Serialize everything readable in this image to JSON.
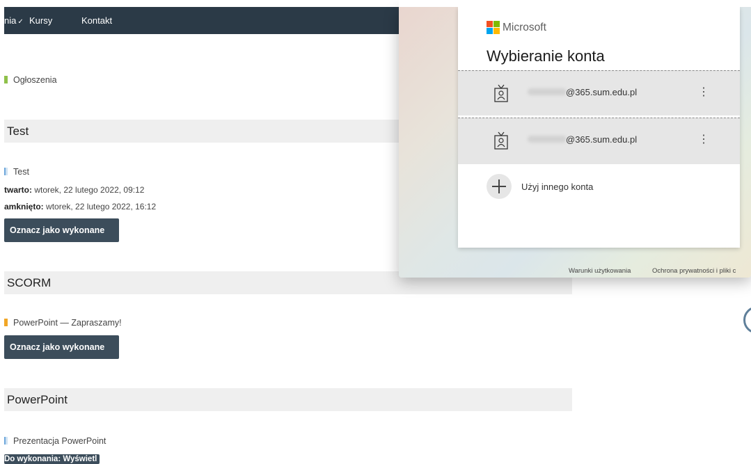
{
  "nav": {
    "menu_label": "nia",
    "kursy": "Kursy",
    "kontakt": "Kontakt"
  },
  "course": {
    "announcements": "Ogłoszenia",
    "sections": [
      {
        "title": "Test",
        "activity": "Test",
        "opened_label": "twarto:",
        "opened_value": " wtorek, 22 lutego 2022, 09:12",
        "closed_label": "amknięto:",
        "closed_value": " wtorek, 22 lutego 2022, 16:12",
        "button": "Oznacz jako wykonane"
      },
      {
        "title": "SCORM",
        "activity": "PowerPoint — Zapraszamy!",
        "button": "Oznacz jako wykonane"
      },
      {
        "title": "PowerPoint",
        "activity": "Prezentacja PowerPoint",
        "badge": "Do wykonania: Wyświetl"
      }
    ]
  },
  "popup": {
    "brand": "Microsoft",
    "title": "Wybieranie konta",
    "accounts": [
      {
        "email": "@365.sum.edu.pl",
        "more": "⋮"
      },
      {
        "email": "@365.sum.edu.pl",
        "more": "⋮"
      }
    ],
    "other_account": "Użyj innego konta",
    "footer": {
      "terms": "Warunki użytkowania",
      "privacy": "Ochrona prywatności i pliki c"
    }
  },
  "colors": {
    "navbar": "#2b3a47",
    "button": "#3c4d5b",
    "ms_red": "#f25022",
    "ms_green": "#7fba00",
    "ms_blue": "#00a4ef",
    "ms_yellow": "#ffb900"
  }
}
